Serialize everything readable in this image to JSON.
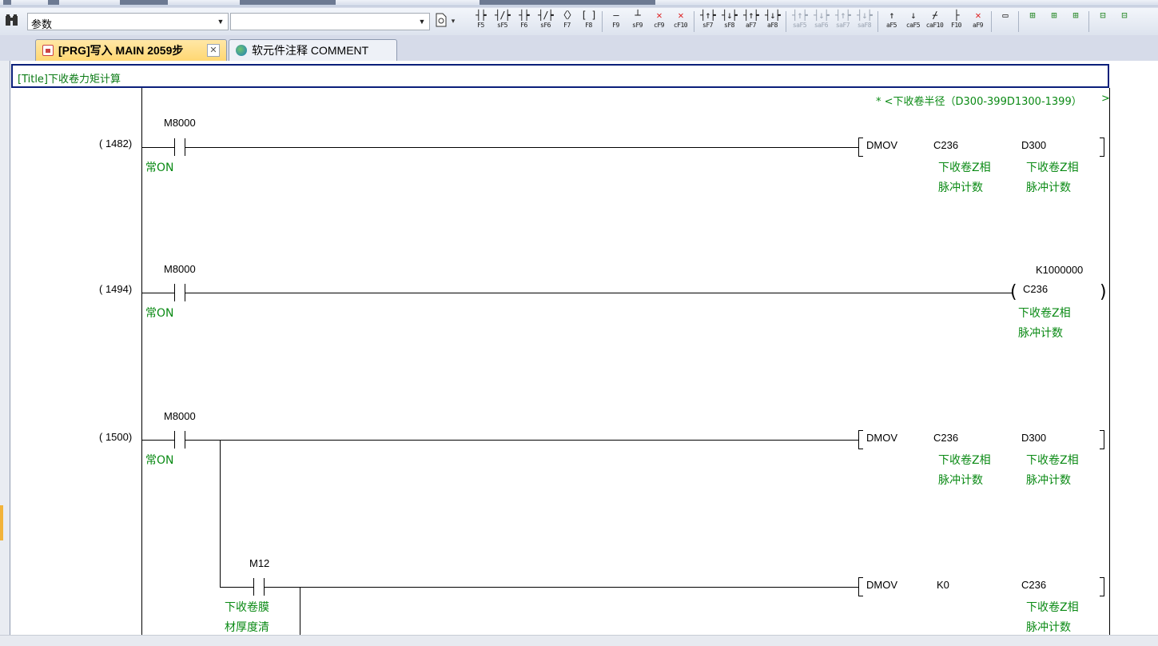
{
  "toolbar": {
    "search_combo_value": "参数",
    "tools": [
      {
        "glyph": "┤┝",
        "key": "F5"
      },
      {
        "glyph": "┤/┝",
        "key": "sF5"
      },
      {
        "glyph": "┤┝",
        "key": "F6"
      },
      {
        "glyph": "┤/┝",
        "key": "sF6"
      },
      {
        "glyph": "〈〉",
        "key": "F7"
      },
      {
        "glyph": "[ ]",
        "key": "F8"
      },
      {
        "glyph": "—",
        "key": "F9"
      },
      {
        "glyph": "┴",
        "key": "sF9"
      },
      {
        "glyph": "✕",
        "key": "cF9"
      },
      {
        "glyph": "✕",
        "key": "cF10"
      },
      {
        "glyph": "┤↑┝",
        "key": "sF7"
      },
      {
        "glyph": "┤↓┝",
        "key": "sF8"
      },
      {
        "glyph": "┤↑┝",
        "key": "aF7"
      },
      {
        "glyph": "┤↓┝",
        "key": "aF8"
      },
      {
        "glyph": "┤↑┝",
        "key": "saF5"
      },
      {
        "glyph": "┤↓┝",
        "key": "saF6"
      },
      {
        "glyph": "┤↑┝",
        "key": "saF7"
      },
      {
        "glyph": "┤↓┝",
        "key": "saF8"
      },
      {
        "glyph": "↑",
        "key": "aF5"
      },
      {
        "glyph": "↓",
        "key": "caF5"
      },
      {
        "glyph": "⌿",
        "key": "caF10"
      },
      {
        "glyph": "├",
        "key": "F10"
      },
      {
        "glyph": "✕",
        "key": "aF9"
      },
      {
        "glyph": "▭",
        "key": ""
      },
      {
        "glyph": "⊞",
        "key": ""
      },
      {
        "glyph": "⊞",
        "key": ""
      },
      {
        "glyph": "⊞",
        "key": ""
      },
      {
        "glyph": "⊟",
        "key": ""
      },
      {
        "glyph": "⊟",
        "key": ""
      }
    ]
  },
  "tabs": [
    {
      "label": "[PRG]写入 MAIN 2059步",
      "close": "✕"
    },
    {
      "label": "软元件注释 COMMENT"
    }
  ],
  "ladder": {
    "title": "[Title]下收卷力矩计算",
    "statement": "* <下收卷半径（D300-399D1300-1399）",
    "statement_end": ">",
    "rungs": [
      {
        "step": "( 1482)",
        "contact": "M8000",
        "contact_comment": "常ON",
        "instruction": "DMOV",
        "op1": "C236",
        "op1_comment1": "下收卷Z相",
        "op1_comment2": "脉冲计数",
        "op2": "D300",
        "op2_comment1": "下收卷Z相",
        "op2_comment2": "脉冲计数"
      },
      {
        "step": "( 1494)",
        "contact": "M8000",
        "contact_comment": "常ON",
        "setval": "K1000000",
        "coil": "C236",
        "coil_comment1": "下收卷Z相",
        "coil_comment2": "脉冲计数"
      },
      {
        "step": "( 1500)",
        "contact": "M8000",
        "contact_comment": "常ON",
        "instruction": "DMOV",
        "op1": "C236",
        "op1_comment1": "下收卷Z相",
        "op1_comment2": "脉冲计数",
        "op2": "D300",
        "op2_comment1": "下收卷Z相",
        "op2_comment2": "脉冲计数"
      },
      {
        "contact": "M12",
        "contact_comment1": "下收卷膜",
        "contact_comment2": "材厚度清",
        "instruction": "DMOV",
        "op1": "K0",
        "op2": "C236",
        "op2_comment1": "下收卷Z相",
        "op2_comment2": "脉冲计数"
      }
    ]
  }
}
